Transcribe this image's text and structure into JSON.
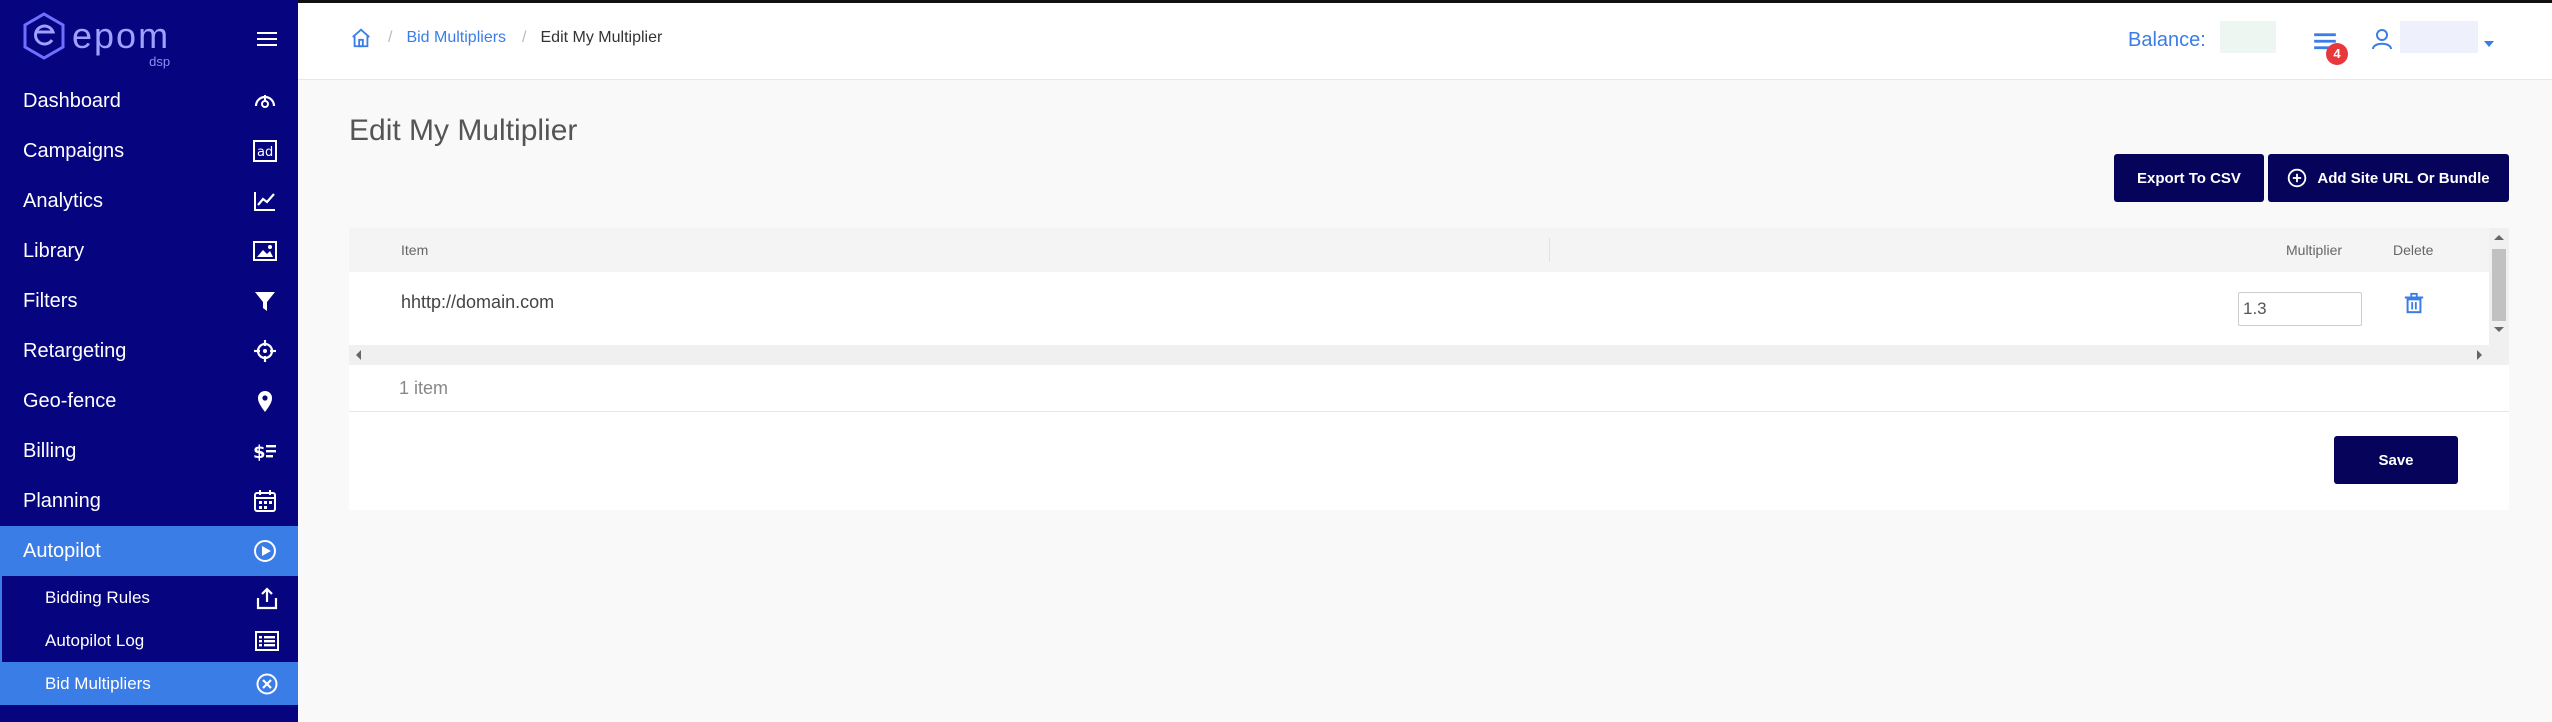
{
  "sidebar": {
    "logo": {
      "word": "epom",
      "sub": "dsp"
    },
    "items": [
      {
        "label": "Dashboard",
        "icon": "gauge-icon"
      },
      {
        "label": "Campaigns",
        "icon": "ad-icon"
      },
      {
        "label": "Analytics",
        "icon": "chart-line-icon"
      },
      {
        "label": "Library",
        "icon": "image-icon"
      },
      {
        "label": "Filters",
        "icon": "funnel-icon"
      },
      {
        "label": "Retargeting",
        "icon": "crosshair-icon"
      },
      {
        "label": "Geo-fence",
        "icon": "map-pin-icon"
      },
      {
        "label": "Billing",
        "icon": "dollar-list-icon"
      },
      {
        "label": "Planning",
        "icon": "calendar-icon"
      },
      {
        "label": "Autopilot",
        "icon": "play-circle-icon"
      }
    ],
    "subitems": [
      {
        "label": "Bidding Rules",
        "icon": "upload-icon"
      },
      {
        "label": "Autopilot Log",
        "icon": "list-icon"
      },
      {
        "label": "Bid Multipliers",
        "icon": "close-circle-icon"
      }
    ]
  },
  "topbar": {
    "breadcrumb": {
      "parent": "Bid Multipliers",
      "current": "Edit My Multiplier",
      "separator": "/"
    },
    "balance_label": "Balance:",
    "notifications_count": "4"
  },
  "main": {
    "title": "Edit My Multiplier",
    "export_label": "Export To CSV",
    "add_label": "Add Site URL Or Bundle",
    "table": {
      "columns": {
        "item": "Item",
        "multiplier": "Multiplier",
        "delete": "Delete"
      },
      "rows": [
        {
          "item": "hhttp://domain.com",
          "multiplier": "1.3"
        }
      ]
    },
    "count_label": "1 item",
    "save_label": "Save"
  },
  "colors": {
    "sidebar_bg": "#06047f",
    "accent": "#3b7de7",
    "button_bg": "#06045a",
    "badge": "#e8383d"
  }
}
